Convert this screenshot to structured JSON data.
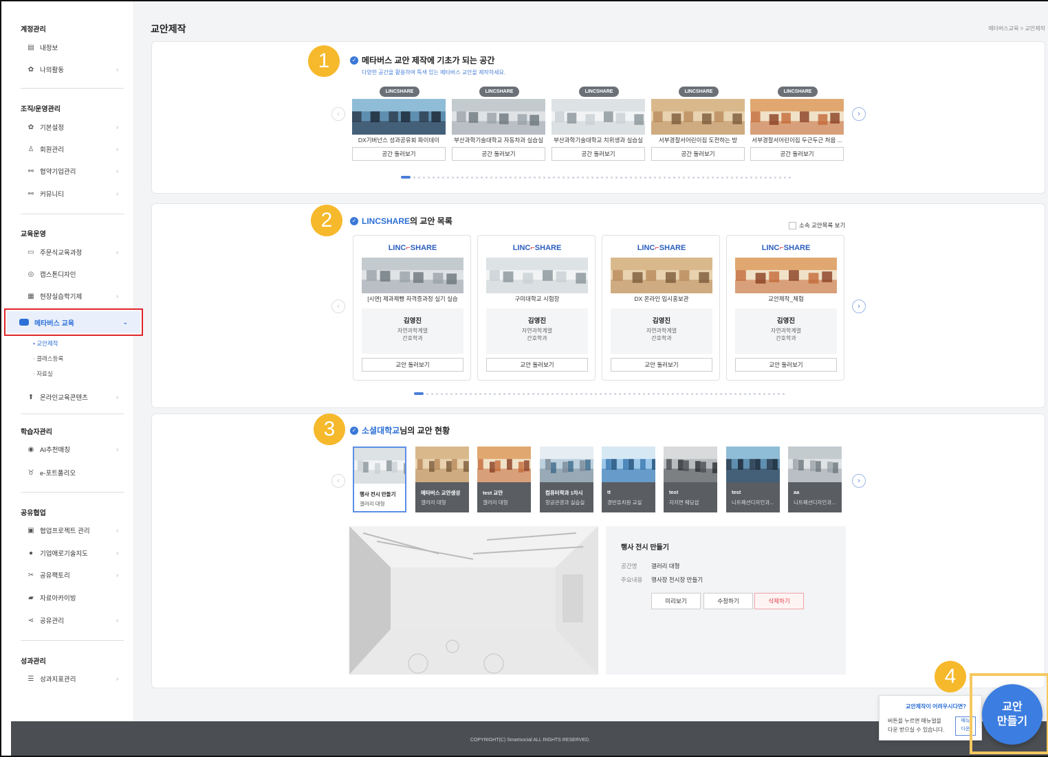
{
  "sidebar": {
    "sections": [
      {
        "title": "계정관리",
        "items": [
          {
            "label": "내정보",
            "icon": "id-card-icon",
            "chevron": false
          },
          {
            "label": "나의활동",
            "icon": "gear-icon",
            "chevron": true
          }
        ]
      },
      {
        "title": "조직/운영관리",
        "items": [
          {
            "label": "기본설정",
            "icon": "gear-icon"
          },
          {
            "label": "회원관리",
            "icon": "users-icon"
          },
          {
            "label": "협약기업관리",
            "icon": "org-chart-icon"
          },
          {
            "label": "커뮤니티",
            "icon": "org-chart-icon"
          }
        ]
      },
      {
        "title": "교육운영",
        "items": [
          {
            "label": "주문식교육과정",
            "icon": "chat-icon"
          },
          {
            "label": "캡스톤디자인",
            "icon": "palette-icon"
          },
          {
            "label": "현장실습학기제",
            "icon": "document-icon"
          }
        ]
      },
      {
        "title": "학습자관리",
        "items": [
          {
            "label": "AI추천매칭",
            "icon": "target-icon"
          },
          {
            "label": "e-포트폴리오",
            "icon": "award-icon"
          }
        ]
      },
      {
        "title": "공유협업",
        "items": [
          {
            "label": "협업프로젝트 관리",
            "icon": "board-icon"
          },
          {
            "label": "기업애로기술지도",
            "icon": "circle-icon"
          },
          {
            "label": "공유팩토리",
            "icon": "tools-icon"
          },
          {
            "label": "자료아카이빙",
            "icon": "folder-icon"
          },
          {
            "label": "공유관리",
            "icon": "share-icon"
          }
        ]
      },
      {
        "title": "성과관리",
        "items": [
          {
            "label": "성과지표관리",
            "icon": "list-icon"
          }
        ]
      }
    ],
    "active_item": "메타버스 교육",
    "sub_items": [
      "교안제작",
      "클래스등록",
      "자료실"
    ],
    "after_active": "온라인교육콘텐츠"
  },
  "header": {
    "title": "교안제작",
    "breadcrumb": "메타버스교육  >  교안제작"
  },
  "section1": {
    "badge": "1",
    "title": "메타버스 교안 제작에 기초가 되는 공간",
    "subtitle": "다양한 공간을 활용하여 특색 있는 메타버스 교안을 제작하세요.",
    "cards": [
      {
        "tag": "LINCSHARE",
        "caption": "DX기버넌스 성과공유회 파이데이",
        "button": "공간 둘러보기"
      },
      {
        "tag": "LINCSHARE",
        "caption": "부산과학기술대학교 자동차과 실습실",
        "button": "공간 둘러보기"
      },
      {
        "tag": "LINCSHARE",
        "caption": "부산과학기술대학교 치위생과 실습실",
        "button": "공간 둘러보기"
      },
      {
        "tag": "LINCSHARE",
        "caption": "서부경찰서어린이집 도전하는 방",
        "button": "공간 둘러보기"
      },
      {
        "tag": "LINCSHARE",
        "caption": "서부경찰서어린이집 두근두근 처음 ...",
        "button": "공간 둘러보기"
      }
    ]
  },
  "section2": {
    "badge": "2",
    "title_highlight": "LINCSHARE",
    "title_rest": "의 교안 목록",
    "checkbox_label": "소속 교안목록 보기",
    "logo_left": "LINC",
    "logo_right": "SHARE",
    "cards": [
      {
        "caption": "[시연] 제과제빵 자격증과정 실기 실습",
        "name": "김영진",
        "dept1": "자연과학계열",
        "dept2": "간호학과",
        "button": "교안 둘러보기"
      },
      {
        "caption": "구미대학교 시험장",
        "name": "김영진",
        "dept1": "자연과학계열",
        "dept2": "간호학과",
        "button": "교안 둘러보기"
      },
      {
        "caption": "DX 온라인 입시홍보관",
        "name": "김영진",
        "dept1": "자연과학계열",
        "dept2": "간호학과",
        "button": "교안 둘러보기"
      },
      {
        "caption": "교안제작_체험",
        "name": "김영진",
        "dept1": "자연과학계열",
        "dept2": "간호학과",
        "button": "교안 둘러보기"
      }
    ]
  },
  "section3": {
    "badge": "3",
    "title_highlight": "소셜대학교",
    "title_rest": "님의 교안 현황",
    "thumbs": [
      {
        "t1": "행사 전시 만들기",
        "t2": "갤러리 대형"
      },
      {
        "t1": "메타버스 교안생성",
        "t2": "갤러리 대형"
      },
      {
        "t1": "test 교안",
        "t2": "갤러리 대형"
      },
      {
        "t1": "컴퓨터학과 1차시",
        "t2": "항공관광과 실습실"
      },
      {
        "t1": "tt",
        "t2": "경빈유치원 교실"
      },
      {
        "t1": "test",
        "t2": "자지연 웨딩샵"
      },
      {
        "t1": "test",
        "t2": "니트패션디자인과..."
      },
      {
        "t1": "aa",
        "t2": "니트패션디자인과..."
      }
    ],
    "detail": {
      "title": "행사 전시 만들기",
      "space_key": "공간명",
      "space_val": "갤러리 대형",
      "content_key": "주요내용",
      "content_val": "행사장 전시장 만들기",
      "btn_preview": "미리보기",
      "btn_edit": "수정하기",
      "btn_delete": "삭제하기"
    }
  },
  "help": {
    "heading": "교안제작이 어려우시다면?",
    "line1": "버튼을 누르면 매뉴얼을",
    "line2": "다운 받으실 수 있습니다.",
    "mini1": "매뉴",
    "mini2": "다운"
  },
  "make_button": {
    "line1": "교안",
    "line2": "만들기",
    "badge": "4"
  },
  "footer": "COPYRIGHT(C) Smartsocial ALL RIGHTS RESERVED.",
  "colors": {
    "accent": "#2c6fd6",
    "badge": "#f6b92c",
    "highlight_border": "#e0242b",
    "footer": "#4b4e53"
  }
}
